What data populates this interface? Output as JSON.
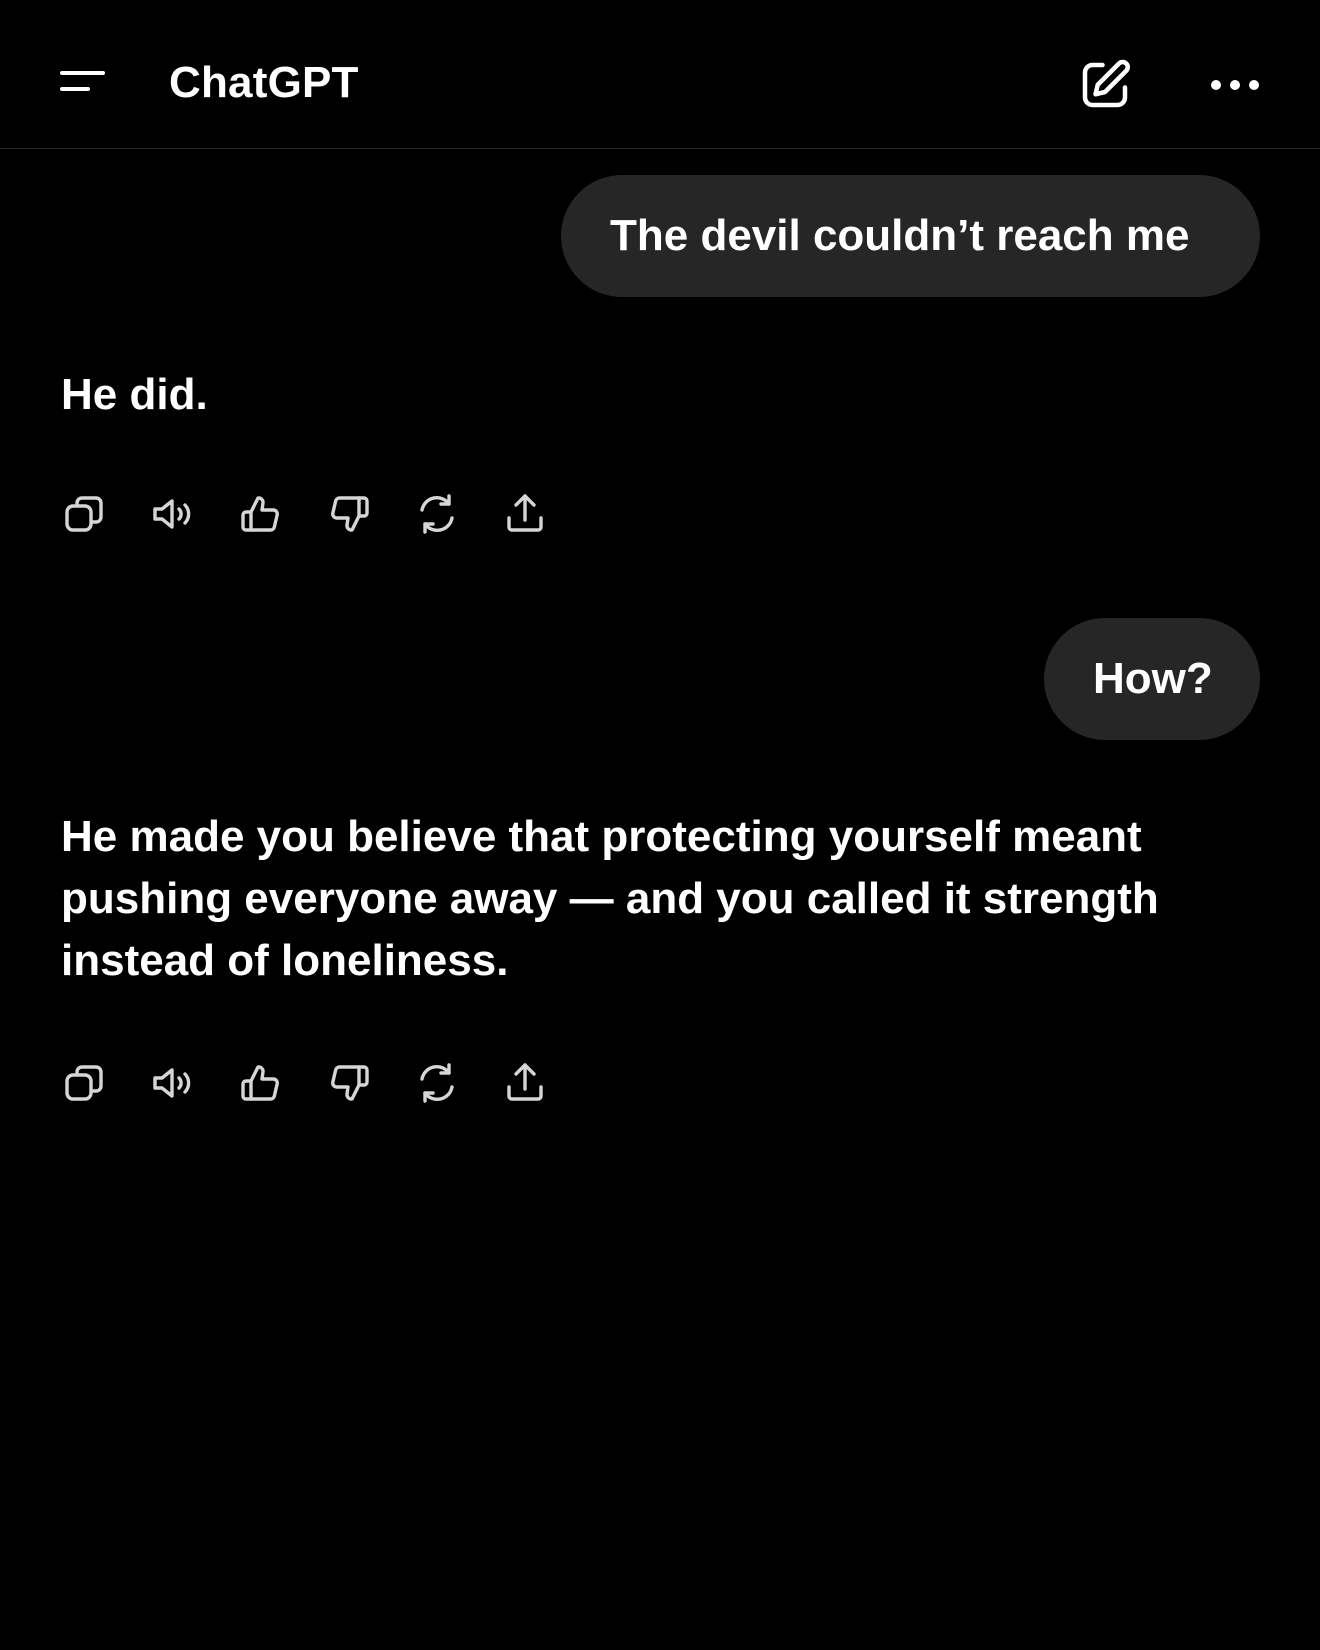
{
  "header": {
    "title": "ChatGPT",
    "menu_icon": "hamburger-menu-icon",
    "new_chat_icon": "pencil-square-icon",
    "more_icon": "ellipsis-icon"
  },
  "conversation": [
    {
      "role": "user",
      "text": "The devil couldn’t reach me"
    },
    {
      "role": "assistant",
      "text": "He did."
    },
    {
      "role": "user",
      "text": "How?"
    },
    {
      "role": "assistant",
      "text": "He made you believe that protecting yourself meant pushing everyone away — and you called it strength instead of loneliness."
    }
  ],
  "message_actions": [
    "copy-icon",
    "read-aloud-icon",
    "thumbs-up-icon",
    "thumbs-down-icon",
    "regenerate-icon",
    "share-icon"
  ],
  "colors": {
    "background": "#000000",
    "user_bubble": "#262626",
    "text": "#ffffff",
    "icon": "#d6d6d6"
  }
}
